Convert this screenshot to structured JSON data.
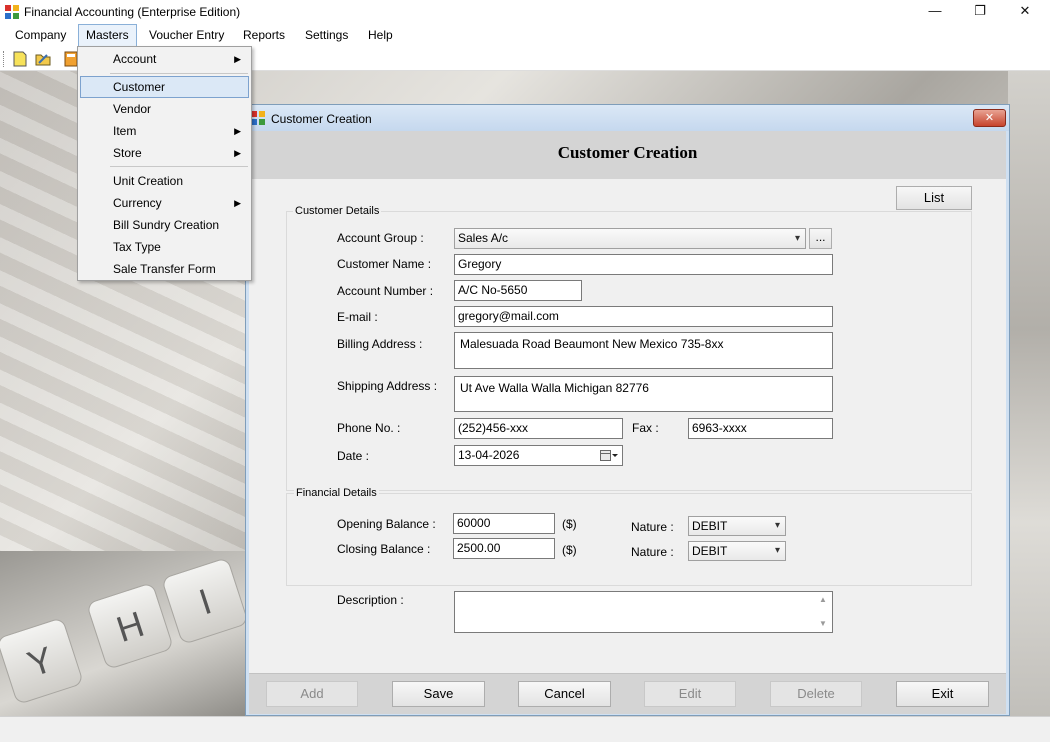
{
  "window": {
    "title": "Financial Accounting (Enterprise Edition)",
    "minimize": "—",
    "maximize": "❐",
    "close": "✕"
  },
  "menubar": {
    "items": [
      "Company",
      "Masters",
      "Voucher Entry",
      "Reports",
      "Settings",
      "Help"
    ]
  },
  "masters_menu": {
    "items": [
      {
        "label": "Account",
        "submenu": true
      },
      {
        "label": "Customer",
        "submenu": false
      },
      {
        "label": "Vendor",
        "submenu": false
      },
      {
        "label": "Item",
        "submenu": true
      },
      {
        "label": "Store",
        "submenu": true
      },
      {
        "label": "Unit Creation",
        "submenu": false
      },
      {
        "label": "Currency",
        "submenu": true
      },
      {
        "label": "Bill Sundry Creation",
        "submenu": false
      },
      {
        "label": "Tax Type",
        "submenu": false
      },
      {
        "label": "Sale Transfer Form",
        "submenu": false
      }
    ],
    "arrow": "▶"
  },
  "dialog": {
    "title": "Customer Creation",
    "heading": "Customer Creation",
    "close": "✕",
    "list_button": "List",
    "customer_details": {
      "group_label": "Customer Details",
      "account_group_label": "Account Group :",
      "account_group_value": "Sales A/c",
      "account_group_more": "...",
      "customer_name_label": "Customer Name :",
      "customer_name_value": "Gregory",
      "account_number_label": "Account Number :",
      "account_number_value": "A/C No-5650",
      "email_label": "E-mail :",
      "email_value": "gregory@mail.com",
      "billing_address_label": "Billing Address :",
      "billing_address_value": "Malesuada Road Beaumont New Mexico 735-8xx",
      "shipping_address_label": "Shipping Address :",
      "shipping_address_value": "Ut Ave Walla Walla Michigan 82776",
      "phone_label": "Phone No. :",
      "phone_value": "(252)456-xxx",
      "fax_label": "Fax :",
      "fax_value": "6963-xxxx",
      "date_label": "Date :",
      "date_value": "13-04-2026"
    },
    "financial_details": {
      "group_label": "Financial Details",
      "opening_balance_label": "Opening Balance :",
      "opening_balance_value": "60000",
      "opening_currency": "($)",
      "opening_nature_label": "Nature :",
      "opening_nature_value": "DEBIT",
      "closing_balance_label": "Closing Balance :",
      "closing_balance_value": "2500.00",
      "closing_currency": "($)",
      "closing_nature_label": "Nature :",
      "closing_nature_value": "DEBIT"
    },
    "description_label": "Description :",
    "description_value": "",
    "buttons": {
      "add": "Add",
      "save": "Save",
      "cancel": "Cancel",
      "edit": "Edit",
      "delete": "Delete",
      "exit": "Exit"
    }
  },
  "icons": {
    "app": "app-logo-icon",
    "toolbar": [
      "new-file-icon",
      "open-folder-icon",
      "calculator-icon"
    ],
    "dropdown_chevron": "▾"
  },
  "colors": {
    "menu_highlight": "#dbe8f6",
    "dialog_frame": "#cfe0f2",
    "close_button": "#c7432c"
  }
}
